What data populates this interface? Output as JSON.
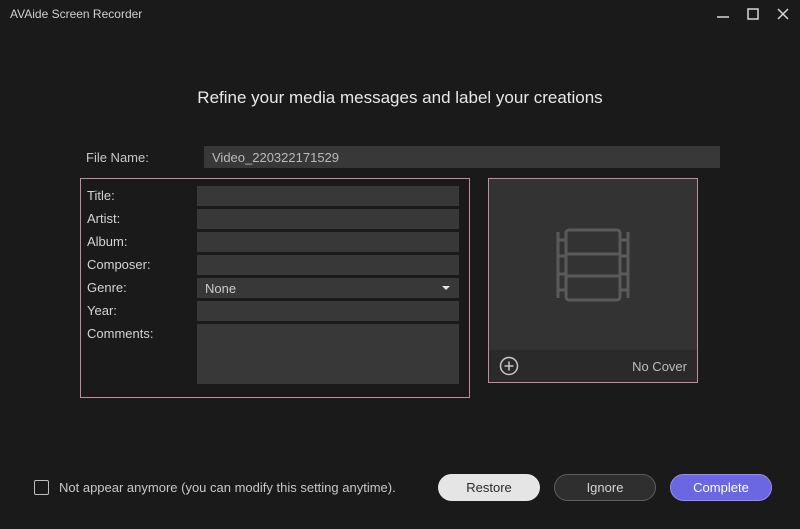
{
  "titlebar": {
    "app_title": "AVAide Screen Recorder"
  },
  "heading": "Refine your media messages and label your creations",
  "file": {
    "label": "File Name:",
    "value": "Video_220322171529"
  },
  "meta": {
    "title_label": "Title:",
    "title_value": "",
    "artist_label": "Artist:",
    "artist_value": "",
    "album_label": "Album:",
    "album_value": "",
    "composer_label": "Composer:",
    "composer_value": "",
    "genre_label": "Genre:",
    "genre_value": "None",
    "year_label": "Year:",
    "year_value": "",
    "comments_label": "Comments:",
    "comments_value": ""
  },
  "cover": {
    "no_cover": "No Cover"
  },
  "footer": {
    "checkbox_label": "Not appear anymore (you can modify this setting anytime).",
    "restore": "Restore",
    "ignore": "Ignore",
    "complete": "Complete"
  }
}
